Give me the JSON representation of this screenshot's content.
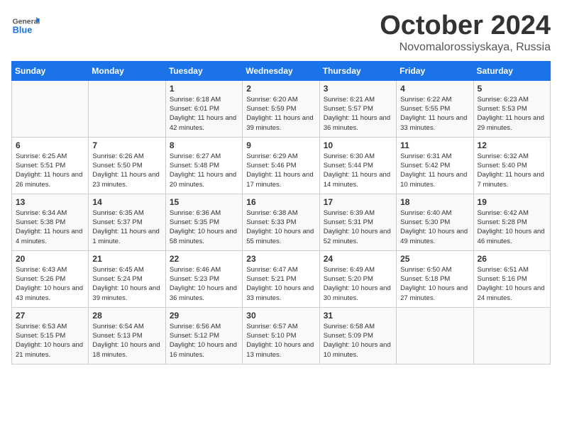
{
  "header": {
    "logo_general": "General",
    "logo_blue": "Blue",
    "month": "October 2024",
    "location": "Novomalorossiyskaya, Russia"
  },
  "days_of_week": [
    "Sunday",
    "Monday",
    "Tuesday",
    "Wednesday",
    "Thursday",
    "Friday",
    "Saturday"
  ],
  "weeks": [
    [
      {
        "day": "",
        "sunrise": "",
        "sunset": "",
        "daylight": ""
      },
      {
        "day": "",
        "sunrise": "",
        "sunset": "",
        "daylight": ""
      },
      {
        "day": "1",
        "sunrise": "Sunrise: 6:18 AM",
        "sunset": "Sunset: 6:01 PM",
        "daylight": "Daylight: 11 hours and 42 minutes."
      },
      {
        "day": "2",
        "sunrise": "Sunrise: 6:20 AM",
        "sunset": "Sunset: 5:59 PM",
        "daylight": "Daylight: 11 hours and 39 minutes."
      },
      {
        "day": "3",
        "sunrise": "Sunrise: 6:21 AM",
        "sunset": "Sunset: 5:57 PM",
        "daylight": "Daylight: 11 hours and 36 minutes."
      },
      {
        "day": "4",
        "sunrise": "Sunrise: 6:22 AM",
        "sunset": "Sunset: 5:55 PM",
        "daylight": "Daylight: 11 hours and 33 minutes."
      },
      {
        "day": "5",
        "sunrise": "Sunrise: 6:23 AM",
        "sunset": "Sunset: 5:53 PM",
        "daylight": "Daylight: 11 hours and 29 minutes."
      }
    ],
    [
      {
        "day": "6",
        "sunrise": "Sunrise: 6:25 AM",
        "sunset": "Sunset: 5:51 PM",
        "daylight": "Daylight: 11 hours and 26 minutes."
      },
      {
        "day": "7",
        "sunrise": "Sunrise: 6:26 AM",
        "sunset": "Sunset: 5:50 PM",
        "daylight": "Daylight: 11 hours and 23 minutes."
      },
      {
        "day": "8",
        "sunrise": "Sunrise: 6:27 AM",
        "sunset": "Sunset: 5:48 PM",
        "daylight": "Daylight: 11 hours and 20 minutes."
      },
      {
        "day": "9",
        "sunrise": "Sunrise: 6:29 AM",
        "sunset": "Sunset: 5:46 PM",
        "daylight": "Daylight: 11 hours and 17 minutes."
      },
      {
        "day": "10",
        "sunrise": "Sunrise: 6:30 AM",
        "sunset": "Sunset: 5:44 PM",
        "daylight": "Daylight: 11 hours and 14 minutes."
      },
      {
        "day": "11",
        "sunrise": "Sunrise: 6:31 AM",
        "sunset": "Sunset: 5:42 PM",
        "daylight": "Daylight: 11 hours and 10 minutes."
      },
      {
        "day": "12",
        "sunrise": "Sunrise: 6:32 AM",
        "sunset": "Sunset: 5:40 PM",
        "daylight": "Daylight: 11 hours and 7 minutes."
      }
    ],
    [
      {
        "day": "13",
        "sunrise": "Sunrise: 6:34 AM",
        "sunset": "Sunset: 5:38 PM",
        "daylight": "Daylight: 11 hours and 4 minutes."
      },
      {
        "day": "14",
        "sunrise": "Sunrise: 6:35 AM",
        "sunset": "Sunset: 5:37 PM",
        "daylight": "Daylight: 11 hours and 1 minute."
      },
      {
        "day": "15",
        "sunrise": "Sunrise: 6:36 AM",
        "sunset": "Sunset: 5:35 PM",
        "daylight": "Daylight: 10 hours and 58 minutes."
      },
      {
        "day": "16",
        "sunrise": "Sunrise: 6:38 AM",
        "sunset": "Sunset: 5:33 PM",
        "daylight": "Daylight: 10 hours and 55 minutes."
      },
      {
        "day": "17",
        "sunrise": "Sunrise: 6:39 AM",
        "sunset": "Sunset: 5:31 PM",
        "daylight": "Daylight: 10 hours and 52 minutes."
      },
      {
        "day": "18",
        "sunrise": "Sunrise: 6:40 AM",
        "sunset": "Sunset: 5:30 PM",
        "daylight": "Daylight: 10 hours and 49 minutes."
      },
      {
        "day": "19",
        "sunrise": "Sunrise: 6:42 AM",
        "sunset": "Sunset: 5:28 PM",
        "daylight": "Daylight: 10 hours and 46 minutes."
      }
    ],
    [
      {
        "day": "20",
        "sunrise": "Sunrise: 6:43 AM",
        "sunset": "Sunset: 5:26 PM",
        "daylight": "Daylight: 10 hours and 43 minutes."
      },
      {
        "day": "21",
        "sunrise": "Sunrise: 6:45 AM",
        "sunset": "Sunset: 5:24 PM",
        "daylight": "Daylight: 10 hours and 39 minutes."
      },
      {
        "day": "22",
        "sunrise": "Sunrise: 6:46 AM",
        "sunset": "Sunset: 5:23 PM",
        "daylight": "Daylight: 10 hours and 36 minutes."
      },
      {
        "day": "23",
        "sunrise": "Sunrise: 6:47 AM",
        "sunset": "Sunset: 5:21 PM",
        "daylight": "Daylight: 10 hours and 33 minutes."
      },
      {
        "day": "24",
        "sunrise": "Sunrise: 6:49 AM",
        "sunset": "Sunset: 5:20 PM",
        "daylight": "Daylight: 10 hours and 30 minutes."
      },
      {
        "day": "25",
        "sunrise": "Sunrise: 6:50 AM",
        "sunset": "Sunset: 5:18 PM",
        "daylight": "Daylight: 10 hours and 27 minutes."
      },
      {
        "day": "26",
        "sunrise": "Sunrise: 6:51 AM",
        "sunset": "Sunset: 5:16 PM",
        "daylight": "Daylight: 10 hours and 24 minutes."
      }
    ],
    [
      {
        "day": "27",
        "sunrise": "Sunrise: 6:53 AM",
        "sunset": "Sunset: 5:15 PM",
        "daylight": "Daylight: 10 hours and 21 minutes."
      },
      {
        "day": "28",
        "sunrise": "Sunrise: 6:54 AM",
        "sunset": "Sunset: 5:13 PM",
        "daylight": "Daylight: 10 hours and 18 minutes."
      },
      {
        "day": "29",
        "sunrise": "Sunrise: 6:56 AM",
        "sunset": "Sunset: 5:12 PM",
        "daylight": "Daylight: 10 hours and 16 minutes."
      },
      {
        "day": "30",
        "sunrise": "Sunrise: 6:57 AM",
        "sunset": "Sunset: 5:10 PM",
        "daylight": "Daylight: 10 hours and 13 minutes."
      },
      {
        "day": "31",
        "sunrise": "Sunrise: 6:58 AM",
        "sunset": "Sunset: 5:09 PM",
        "daylight": "Daylight: 10 hours and 10 minutes."
      },
      {
        "day": "",
        "sunrise": "",
        "sunset": "",
        "daylight": ""
      },
      {
        "day": "",
        "sunrise": "",
        "sunset": "",
        "daylight": ""
      }
    ]
  ]
}
